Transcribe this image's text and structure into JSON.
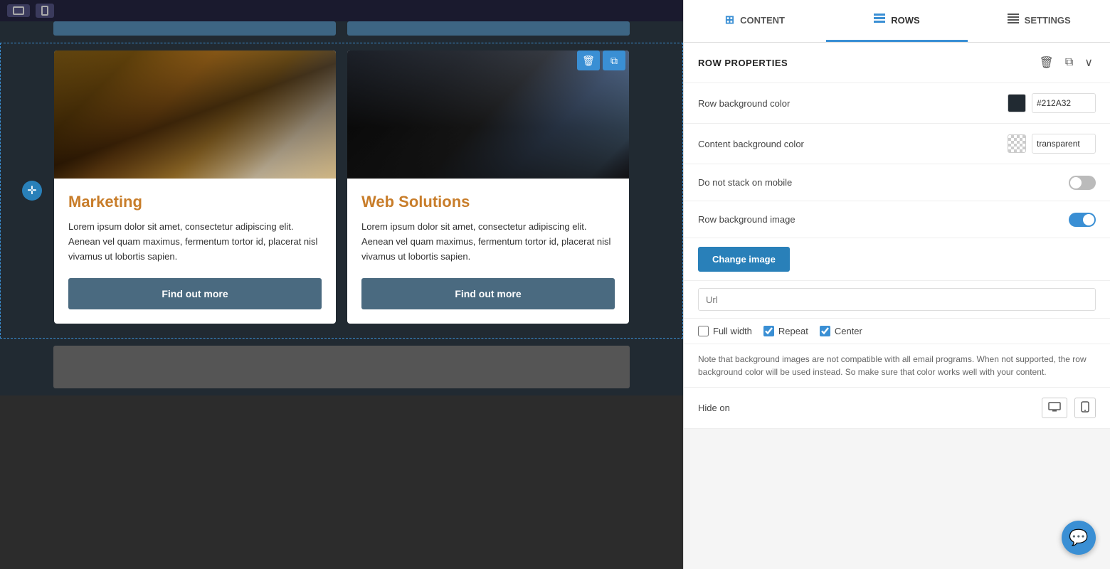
{
  "tabs": [
    {
      "id": "content",
      "label": "CONTENT",
      "icon": "⊞",
      "active": false
    },
    {
      "id": "rows",
      "label": "ROWS",
      "icon": "≡",
      "active": true
    },
    {
      "id": "settings",
      "label": "SETTINGS",
      "icon": "☰",
      "active": false
    }
  ],
  "section": {
    "title": "ROW PROPERTIES"
  },
  "properties": {
    "row_background_color": {
      "label": "Row background color",
      "color": "#212A32",
      "value": "#212A32"
    },
    "content_background_color": {
      "label": "Content background color",
      "value": "transparent"
    },
    "do_not_stack": {
      "label": "Do not stack on mobile",
      "checked": false
    },
    "row_background_image": {
      "label": "Row background image",
      "enabled": true
    },
    "change_image_btn": "Change image",
    "url": {
      "placeholder": "Url"
    },
    "full_width": {
      "label": "Full width",
      "checked": false
    },
    "repeat": {
      "label": "Repeat",
      "checked": true
    },
    "center": {
      "label": "Center",
      "checked": true
    },
    "note": "Note that background images are not compatible with all email programs. When not supported, the row background color will be used instead. So make sure that color works well with your content.",
    "hide_on": {
      "label": "Hide on"
    }
  },
  "cards": [
    {
      "title": "Marketing",
      "text": "Lorem ipsum dolor sit amet, consectetur adipiscing elit. Aenean vel quam maximus, fermentum tortor id, placerat nisl vivamus ut lobortis sapien.",
      "btn_label": "Find out more"
    },
    {
      "title": "Web Solutions",
      "text": "Lorem ipsum dolor sit amet, consectetur adipiscing elit. Aenean vel quam maximus, fermentum tortor id, placerat nisl vivamus ut lobortis sapien.",
      "btn_label": "Find out more"
    }
  ]
}
